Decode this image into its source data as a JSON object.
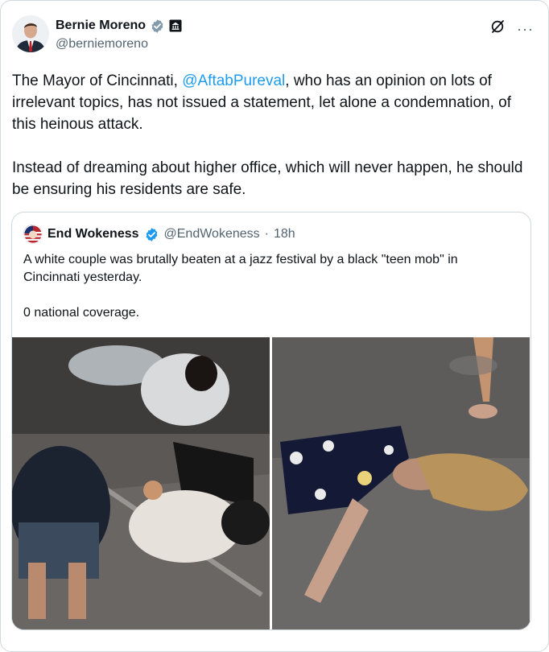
{
  "tweet": {
    "author": {
      "display_name": "Bernie Moreno",
      "handle": "@berniemoreno",
      "verified_icon": "verified-badge-icon",
      "affiliation_icon": "government-building-icon"
    },
    "actions": {
      "grok_icon": "grok-icon",
      "more_label": "···"
    },
    "text": {
      "p1_before": "The Mayor of Cincinnati, ",
      "p1_mention": "@AftabPureval",
      "p1_after": ", who has an opinion on lots of irrelevant topics, has not issued a statement, let alone a condemnation, of this heinous attack.",
      "p2": "Instead of dreaming about higher office, which will never happen, he should be ensuring his residents are safe."
    }
  },
  "quoted_tweet": {
    "author": {
      "display_name": "End Wokeness",
      "handle": "@EndWokeness",
      "separator": "·",
      "time": "18h",
      "verified_icon": "verified-badge-icon"
    },
    "text": {
      "line1": "A white couple was brutally beaten at a jazz festival by a black \"teen mob\" in Cincinnati yesterday.",
      "line2": "0 national coverage."
    },
    "media": [
      {
        "name": "photo-left"
      },
      {
        "name": "photo-right"
      }
    ]
  },
  "colors": {
    "accent": "#1d9bf0",
    "text": "#0f1419",
    "muted": "#536471",
    "border": "#cfd9de"
  }
}
